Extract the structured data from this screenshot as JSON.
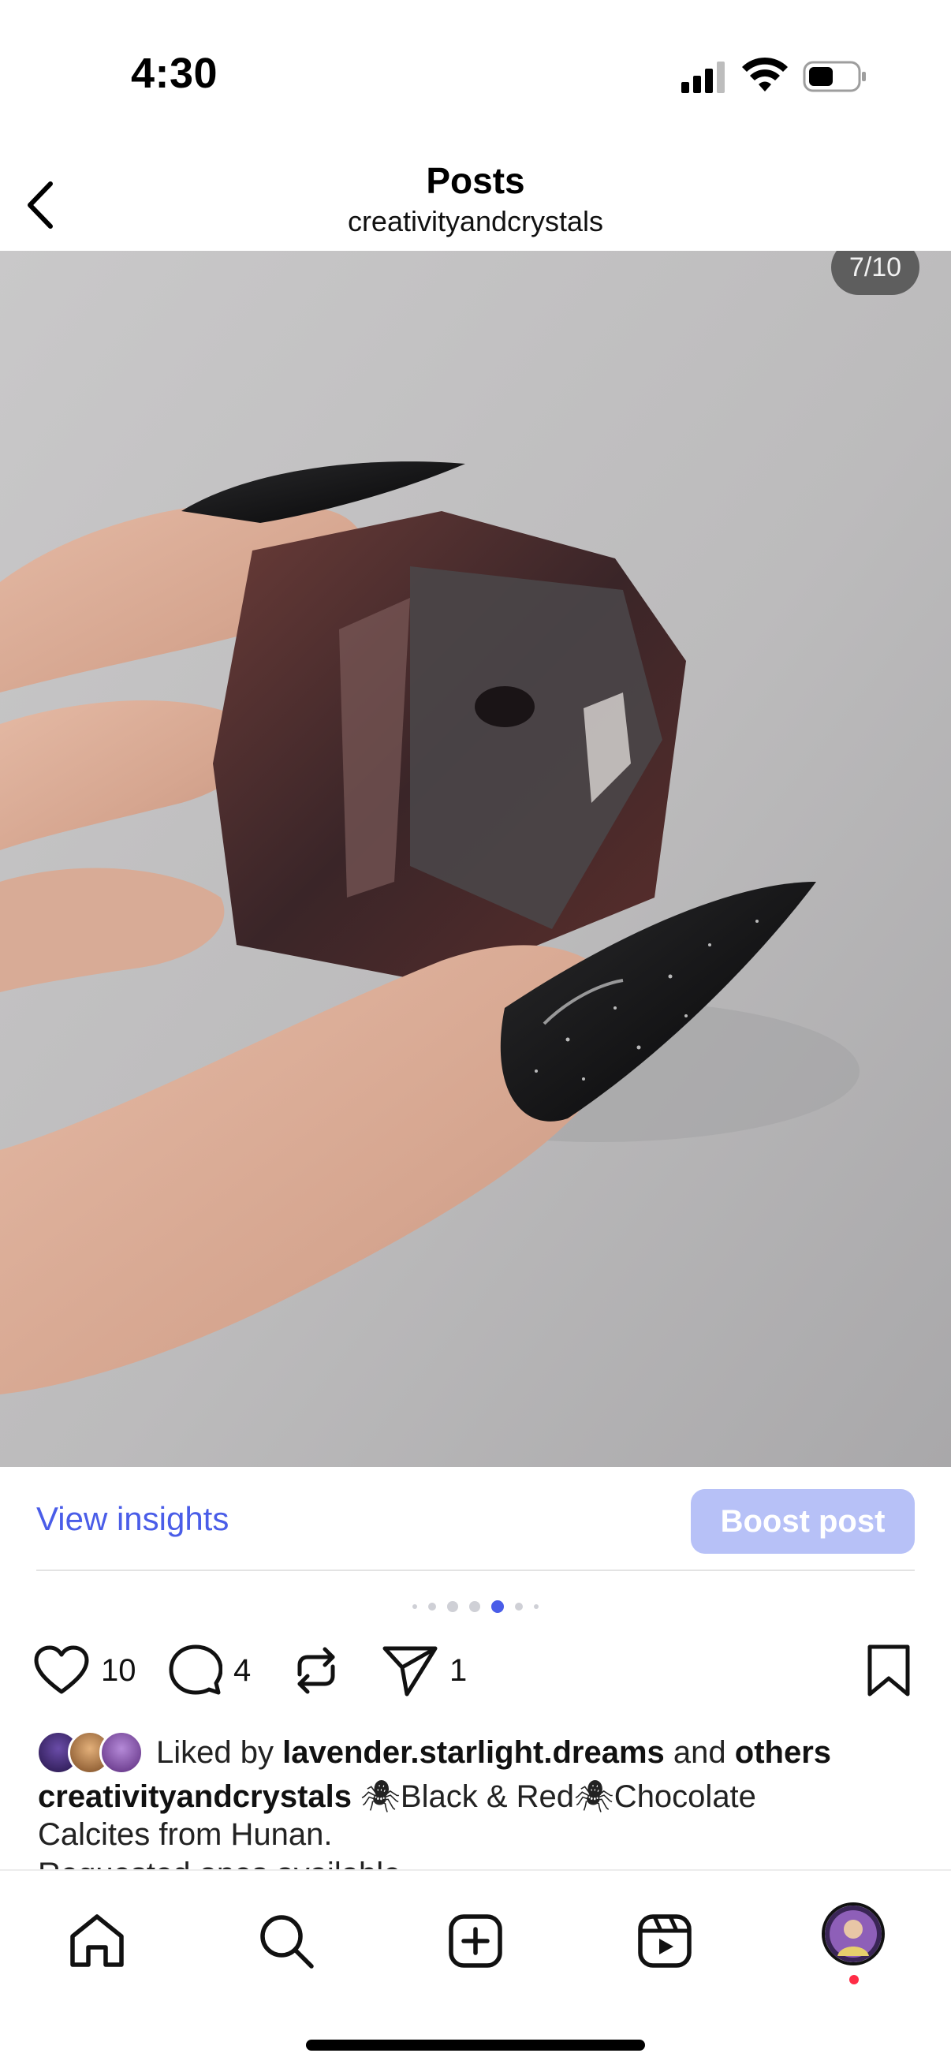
{
  "status_bar": {
    "time": "4:30"
  },
  "header": {
    "title": "Posts",
    "subtitle": "creativityandcrystals"
  },
  "photo": {
    "counter": "7/10",
    "carousel": {
      "current": 7,
      "total": 10,
      "visible_dots": 7,
      "active_dot_index": 4
    }
  },
  "insights": {
    "view_insights_label": "View insights",
    "boost_label": "Boost post"
  },
  "actions": {
    "likes_count": "10",
    "comments_count": "4",
    "shares_count": "1"
  },
  "likes": {
    "prefix": "Liked by",
    "user": "lavender.starlight.dreams",
    "middle": "and",
    "suffix": "others"
  },
  "caption": {
    "username": "creativityandcrystals",
    "line1": "🕷Black & Red🕷Chocolate",
    "line2": "Calcites from Hunan.",
    "line3_partial": "Requested ones available"
  },
  "colors": {
    "accent": "#4a5de8",
    "boost_bg": "#b7c1f7",
    "notification": "#ff2c46"
  },
  "tab_bar": {
    "icons": [
      "home-icon",
      "search-icon",
      "create-icon",
      "reels-icon",
      "profile-avatar"
    ]
  }
}
